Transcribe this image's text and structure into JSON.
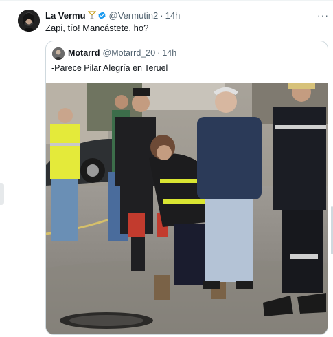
{
  "tweet": {
    "author_name": "La Vermu",
    "author_handle": "@Vermutin2",
    "separator": "·",
    "time": "14h",
    "text": "Zapi, tío! Mancástete, ho?",
    "more_label": "···"
  },
  "quoted": {
    "author_name": "Motarrd",
    "author_handle": "@Motarrd_20",
    "separator": "·",
    "time": "14h",
    "text": "-Parece Pilar Alegría en Teruel"
  },
  "icons": {
    "verified_color": "#1d9bf0",
    "glass_icon": "cocktail-glass-icon",
    "verified_icon": "verified-badge-icon"
  }
}
